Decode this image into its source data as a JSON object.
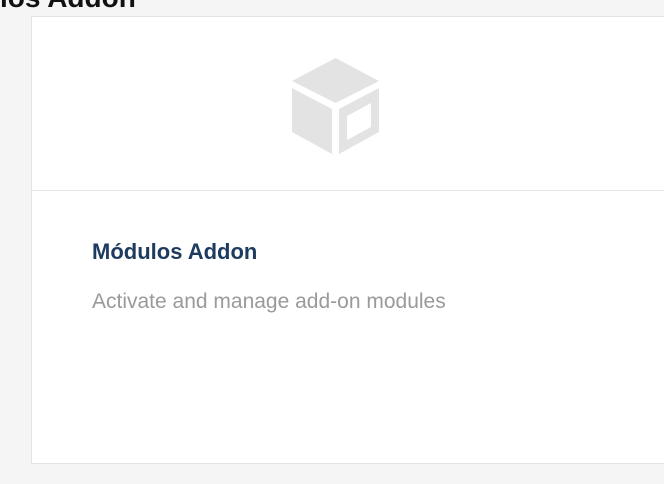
{
  "header": {
    "title": "los Addon"
  },
  "card": {
    "icon": "cube-icon",
    "title": "Módulos Addon",
    "description": "Activate and manage add-on modules"
  },
  "colors": {
    "background": "#f5f5f5",
    "card": "#ffffff",
    "border": "#e4e4e4",
    "icon": "#e3e3e3",
    "title": "#1d3b5e",
    "description": "#9a9a9a"
  }
}
